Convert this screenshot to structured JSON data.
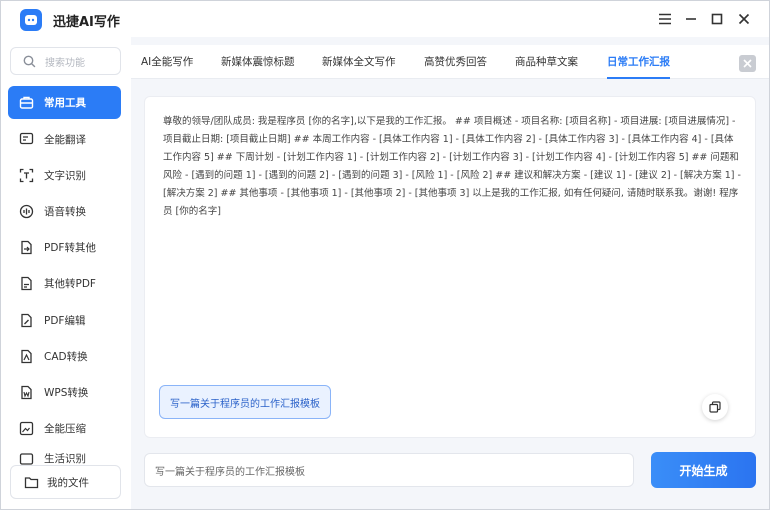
{
  "app": {
    "title": "迅捷AI写作"
  },
  "colors": {
    "accent": "#2b7cf6",
    "chip_bg": "#eaf2ff",
    "main_bg": "#f4f6fa"
  },
  "sidebar": {
    "search_placeholder": "搜索功能",
    "items": [
      {
        "label": "常用工具",
        "icon": "toolbox-icon",
        "active": true
      },
      {
        "label": "全能翻译",
        "icon": "translate-icon"
      },
      {
        "label": "文字识别",
        "icon": "text-scan-icon"
      },
      {
        "label": "语音转换",
        "icon": "audio-convert-icon"
      },
      {
        "label": "PDF转其他",
        "icon": "pdf-export-icon"
      },
      {
        "label": "其他转PDF",
        "icon": "pdf-import-icon"
      },
      {
        "label": "PDF编辑",
        "icon": "pdf-edit-icon"
      },
      {
        "label": "CAD转换",
        "icon": "cad-icon"
      },
      {
        "label": "WPS转换",
        "icon": "wps-icon"
      },
      {
        "label": "全能压缩",
        "icon": "compress-icon"
      },
      {
        "label": "生活识别",
        "icon": "life-scan-icon"
      }
    ],
    "my_files_label": "我的文件"
  },
  "tabs": [
    {
      "label": "AI全能写作"
    },
    {
      "label": "新媒体震惊标题"
    },
    {
      "label": "新媒体全文写作"
    },
    {
      "label": "高赞优秀回答"
    },
    {
      "label": "商品种草文案"
    },
    {
      "label": "日常工作汇报",
      "active": true
    }
  ],
  "content": {
    "text": "尊敬的领导/团队成员: 我是程序员 [你的名字],以下是我的工作汇报。 ## 项目概述 - 项目名称: [项目名称] - 项目进展: [项目进展情况] - 项目截止日期: [项目截止日期] ## 本周工作内容 - [具体工作内容 1] - [具体工作内容 2] - [具体工作内容 3] - [具体工作内容 4] - [具体工作内容 5] ## 下周计划 - [计划工作内容 1] - [计划工作内容 2] - [计划工作内容 3] - [计划工作内容 4] - [计划工作内容 5] ## 问题和风险 - [遇到的问题 1] - [遇到的问题 2] - [遇到的问题 3] - [风险 1] - [风险 2] ## 建议和解决方案 - [建议 1] - [建议 2] - [解决方案 1] - [解决方案 2] ## 其他事项 - [其他事项 1] - [其他事项 2] - [其他事项 3] 以上是我的工作汇报, 如有任何疑问, 请随时联系我。谢谢! 程序员 [你的名字]",
    "template_chip": "写一篇关于程序员的工作汇报模板"
  },
  "input": {
    "value": "写一篇关于程序员的工作汇报模板"
  },
  "generate_button": "开始生成"
}
